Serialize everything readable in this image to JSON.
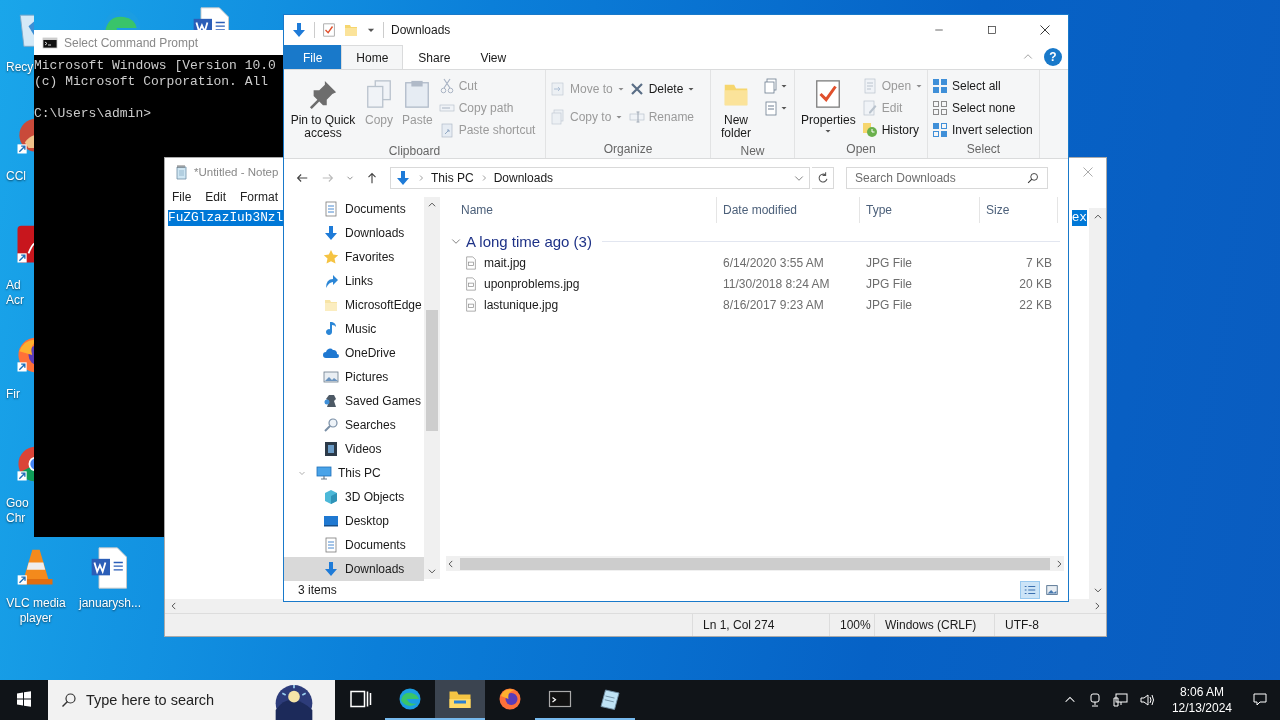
{
  "desktop": {
    "left_column": [
      {
        "kind": "recycle",
        "label_lines": [
          "Recy"
        ]
      },
      {
        "kind": "ccleaner",
        "label_lines": [
          "CCl"
        ]
      },
      {
        "kind": "acrobat",
        "label_lines": [
          "Ad",
          "Acr"
        ]
      },
      {
        "kind": "firefox",
        "label_lines": [
          "Fir"
        ]
      },
      {
        "kind": "chrome",
        "label_lines": [
          "Goo",
          "Chr"
        ]
      }
    ],
    "top_partial": [
      {
        "kind": "edge"
      },
      {
        "kind": "word"
      }
    ],
    "bottom_row": [
      {
        "kind": "vlc",
        "label_lines": [
          "VLC media",
          "player"
        ]
      },
      {
        "kind": "word",
        "label_lines": [
          "januarysh..."
        ]
      }
    ]
  },
  "cmd": {
    "title": "Select Command Prompt",
    "lines": [
      "Microsoft Windows [Version 10.0",
      "(c) Microsoft Corporation. All"
    ],
    "prompt": "C:\\Users\\admin>"
  },
  "notepad": {
    "title": "*Untitled - Notep",
    "menu": [
      "File",
      "Edit",
      "Format"
    ],
    "text_start": {
      "text": "FuZGlzazIub3Nzl",
      "selected": true
    },
    "text_end": {
      "text": "ex",
      "selected": true
    },
    "status": [
      "Ln 1, Col 274",
      "100%",
      "Windows (CRLF)",
      "UTF-8"
    ]
  },
  "explorer": {
    "title": "Downloads",
    "tabs": [
      {
        "label": "File",
        "kind": "file",
        "selected": false
      },
      {
        "label": "Home",
        "kind": "tab",
        "selected": true
      },
      {
        "label": "Share",
        "kind": "tab",
        "selected": false
      },
      {
        "label": "View",
        "kind": "tab",
        "selected": false
      }
    ],
    "help_label": "?",
    "ribbon": [
      {
        "name": "Clipboard",
        "columns": [
          [
            {
              "kind": "pin",
              "label": "Pin to Quick access",
              "disabled": false
            }
          ],
          [
            {
              "kind": "copy",
              "label": "Copy",
              "disabled": true
            }
          ],
          [
            {
              "kind": "paste",
              "label": "Paste",
              "disabled": true
            }
          ],
          [
            {
              "kind": "cut",
              "label": "Cut",
              "disabled": true
            },
            {
              "kind": "copypath",
              "label": "Copy path",
              "disabled": true
            },
            {
              "kind": "pasteshortcut",
              "label": "Paste shortcut",
              "disabled": true
            }
          ]
        ]
      },
      {
        "name": "Organize",
        "columns": [
          [
            {
              "kind": "moveto",
              "label": "Move to",
              "disabled": true,
              "dropdown": true
            },
            {
              "kind": "copyto",
              "label": "Copy to",
              "disabled": true,
              "dropdown": true
            }
          ],
          [
            {
              "kind": "delete",
              "label": "Delete",
              "disabled": false,
              "dropdown": true
            },
            {
              "kind": "rename",
              "label": "Rename",
              "disabled": true
            }
          ]
        ]
      },
      {
        "name": "New",
        "columns": [
          [
            {
              "kind": "newfolder",
              "label": "New folder",
              "disabled": false
            }
          ],
          [
            {
              "kind": "newitem",
              "disabled": false,
              "dropdown": true
            },
            {
              "kind": "easyaccess",
              "disabled": false,
              "dropdown": true
            }
          ]
        ]
      },
      {
        "name": "Open",
        "columns": [
          [
            {
              "kind": "properties",
              "label": "Properties",
              "disabled": false,
              "dropdown": true
            }
          ],
          [
            {
              "kind": "open",
              "label": "Open",
              "disabled": true,
              "dropdown": true
            },
            {
              "kind": "edit",
              "label": "Edit",
              "disabled": true
            },
            {
              "kind": "history",
              "label": "History",
              "disabled": false
            }
          ]
        ]
      },
      {
        "name": "Select",
        "columns": [
          [
            {
              "kind": "selectall",
              "label": "Select all",
              "disabled": false
            },
            {
              "kind": "selectnone",
              "label": "Select none",
              "disabled": false
            },
            {
              "kind": "invert",
              "label": "Invert selection",
              "disabled": false
            }
          ]
        ]
      }
    ],
    "breadcrumbs": [
      "This PC",
      "Downloads"
    ],
    "search": {
      "placeholder": "Search Downloads"
    },
    "nav_pane": {
      "user_items": [
        {
          "label": "Documents",
          "kind": "documents",
          "selected": false
        },
        {
          "label": "Downloads",
          "kind": "downloads",
          "selected": false
        },
        {
          "label": "Favorites",
          "kind": "favorites",
          "selected": false
        },
        {
          "label": "Links",
          "kind": "links",
          "selected": false
        },
        {
          "label": "MicrosoftEdge",
          "kind": "folder",
          "selected": false
        },
        {
          "label": "Music",
          "kind": "music",
          "selected": false
        },
        {
          "label": "OneDrive",
          "kind": "onedrive",
          "selected": false
        },
        {
          "label": "Pictures",
          "kind": "pictures",
          "selected": false
        },
        {
          "label": "Saved Games",
          "kind": "games",
          "selected": false
        },
        {
          "label": "Searches",
          "kind": "searches",
          "selected": false
        },
        {
          "label": "Videos",
          "kind": "videos",
          "selected": false
        }
      ],
      "tree": [
        {
          "label": "This PC",
          "kind": "pc",
          "selected": false,
          "expanded": true,
          "children": [
            {
              "label": "3D Objects",
              "kind": "objects",
              "selected": false
            },
            {
              "label": "Desktop",
              "kind": "desktop",
              "selected": false
            },
            {
              "label": "Documents",
              "kind": "documents",
              "selected": false
            },
            {
              "label": "Downloads",
              "kind": "downloads",
              "selected": true
            }
          ]
        }
      ]
    },
    "columns": [
      "Name",
      "Date modified",
      "Type",
      "Size"
    ],
    "group": {
      "label": "A long time ago (3)",
      "expanded": true
    },
    "files": [
      {
        "name": "mait.jpg",
        "date": "6/14/2020 3:55 AM",
        "type": "JPG File",
        "size": "7 KB"
      },
      {
        "name": "uponproblems.jpg",
        "date": "11/30/2018 8:24 AM",
        "type": "JPG File",
        "size": "20 KB"
      },
      {
        "name": "lastunique.jpg",
        "date": "8/16/2017 9:23 AM",
        "type": "JPG File",
        "size": "22 KB"
      }
    ],
    "status": "3 items",
    "views": [
      {
        "kind": "details",
        "selected": true
      },
      {
        "kind": "large",
        "selected": false
      }
    ]
  },
  "taskbar": {
    "search_placeholder": "Type here to search",
    "apps": [
      {
        "kind": "taskview",
        "running": false,
        "selected": false
      },
      {
        "kind": "edge",
        "running": true,
        "selected": false
      },
      {
        "kind": "explorer",
        "running": true,
        "selected": true
      },
      {
        "kind": "firefox",
        "running": false,
        "selected": false
      },
      {
        "kind": "cmd",
        "running": true,
        "selected": false
      },
      {
        "kind": "notepad",
        "running": true,
        "selected": false
      }
    ],
    "time": "8:06 AM",
    "date": "12/13/2024"
  }
}
